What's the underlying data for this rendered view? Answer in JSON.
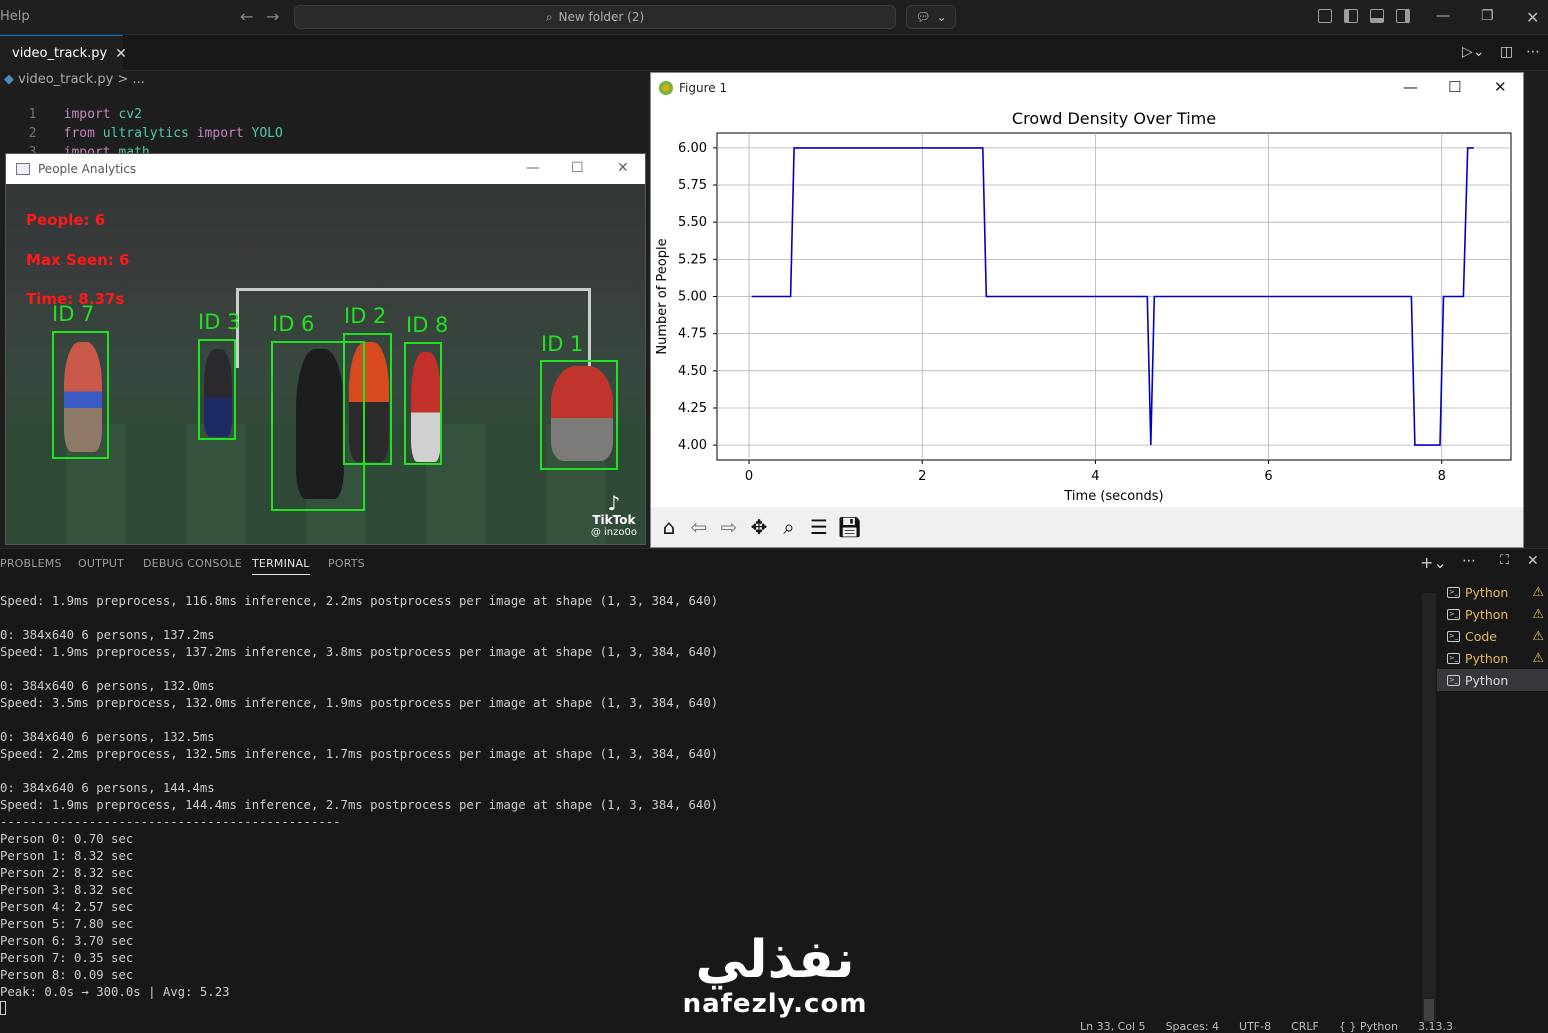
{
  "titlebar": {
    "menu_help": "Help",
    "command_center": "New folder (2)"
  },
  "tabs": {
    "active_label": "video_track.py"
  },
  "editor": {
    "breadcrumb": "video_track.py > ...",
    "lines": [
      {
        "n": "1",
        "t1": "import",
        "t2": " cv2"
      },
      {
        "n": "2",
        "t1": "from",
        "t2": " ultralytics ",
        "t3": "import",
        "t4": " YOLO"
      },
      {
        "n": "3",
        "t1": "import",
        "t2": " math"
      }
    ]
  },
  "people_window": {
    "title": "People Analytics",
    "overlay_people": "People: 6",
    "overlay_max": "Max Seen: 6",
    "overlay_time": "Time: 8.37s",
    "ids": [
      "ID 7",
      "ID 3",
      "ID 6",
      "ID 2",
      "ID 8",
      "ID 1"
    ],
    "watermark_brand": "TikTok",
    "watermark_handle": "@ inzo0o"
  },
  "figure_window": {
    "title": "Figure 1",
    "toolbar_icons": [
      "home-icon",
      "back-icon",
      "forward-icon",
      "pan-icon",
      "zoom-icon",
      "configure-icon",
      "save-icon"
    ]
  },
  "chart_data": {
    "type": "line",
    "title": "Crowd Density Over Time",
    "xlabel": "Time (seconds)",
    "ylabel": "Number of People",
    "xlim": [
      -0.37,
      8.8
    ],
    "ylim": [
      3.9,
      6.1
    ],
    "xticks": [
      "0",
      "2",
      "4",
      "6",
      "8"
    ],
    "yticks": [
      "4.00",
      "4.25",
      "4.50",
      "4.75",
      "5.00",
      "5.25",
      "5.50",
      "5.75",
      "6.00"
    ],
    "grid": true,
    "color": "#0000cc",
    "series": [
      {
        "x": [
          0.03,
          0.48,
          0.52,
          2.7,
          2.74,
          4.6,
          4.64,
          4.68,
          7.65,
          7.69,
          7.98,
          8.02,
          8.25,
          8.3,
          8.37
        ],
        "y": [
          5,
          5,
          6,
          6,
          5,
          5,
          4,
          5,
          5,
          4,
          4,
          5,
          5,
          6,
          6
        ]
      }
    ]
  },
  "panel": {
    "tabs": [
      "PROBLEMS",
      "OUTPUT",
      "DEBUG CONSOLE",
      "TERMINAL",
      "PORTS"
    ],
    "terminal_lines": [
      "Speed: 1.9ms preprocess, 116.8ms inference, 2.2ms postprocess per image at shape (1, 3, 384, 640)",
      "",
      "0: 384x640 6 persons, 137.2ms",
      "Speed: 1.9ms preprocess, 137.2ms inference, 3.8ms postprocess per image at shape (1, 3, 384, 640)",
      "",
      "0: 384x640 6 persons, 132.0ms",
      "Speed: 3.5ms preprocess, 132.0ms inference, 1.9ms postprocess per image at shape (1, 3, 384, 640)",
      "",
      "0: 384x640 6 persons, 132.5ms",
      "Speed: 2.2ms preprocess, 132.5ms inference, 1.7ms postprocess per image at shape (1, 3, 384, 640)",
      "",
      "0: 384x640 6 persons, 144.4ms",
      "Speed: 1.9ms preprocess, 144.4ms inference, 2.7ms postprocess per image at shape (1, 3, 384, 640)",
      "----------------------------------------------",
      "Person 0: 0.70 sec",
      "Person 1: 8.32 sec",
      "Person 2: 8.32 sec",
      "Person 3: 8.32 sec",
      "Person 4: 2.57 sec",
      "Person 5: 7.80 sec",
      "Person 6: 3.70 sec",
      "Person 7: 0.35 sec",
      "Person 8: 0.09 sec",
      "Peak: 0.0s → 300.0s | Avg: 5.23"
    ],
    "terminal_list": [
      {
        "label": "Python",
        "warn": true
      },
      {
        "label": "Python",
        "warn": true
      },
      {
        "label": "Code",
        "warn": true
      },
      {
        "label": "Python",
        "warn": true
      },
      {
        "label": "Python",
        "warn": false
      }
    ]
  },
  "watermark": {
    "arabic": "نفذلي",
    "latin": "nafezly.com"
  },
  "statusbar": {
    "position": "Ln 33, Col 5",
    "spaces": "Spaces: 4",
    "encoding": "UTF-8",
    "eol": "CRLF",
    "language": "{ } Python",
    "version": "3.13.3"
  }
}
